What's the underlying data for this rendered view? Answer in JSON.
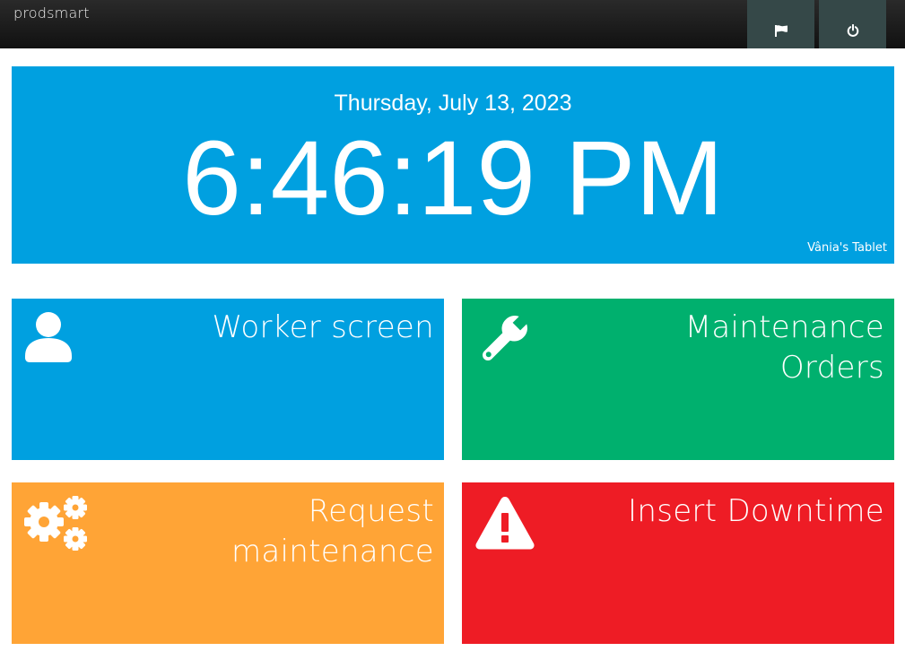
{
  "topbar": {
    "brand": "prodsmart",
    "buttons": [
      {
        "icon": "flag-icon"
      },
      {
        "icon": "power-icon"
      }
    ]
  },
  "clock": {
    "date": "Thursday, July 13, 2023",
    "time": "6:46:19 PM",
    "device": "Vânia's Tablet"
  },
  "tiles": [
    {
      "label_lines": [
        "Worker screen"
      ],
      "icon": "user-icon",
      "color": "#00a0e0"
    },
    {
      "label_lines": [
        "Maintenance",
        "Orders"
      ],
      "icon": "wrench-icon",
      "color": "#00b06e"
    },
    {
      "label_lines": [
        "Request",
        "maintenance"
      ],
      "icon": "gears-icon",
      "color": "#ffa436"
    },
    {
      "label_lines": [
        "Insert Downtime"
      ],
      "icon": "warning-icon",
      "color": "#ee1c25"
    }
  ]
}
